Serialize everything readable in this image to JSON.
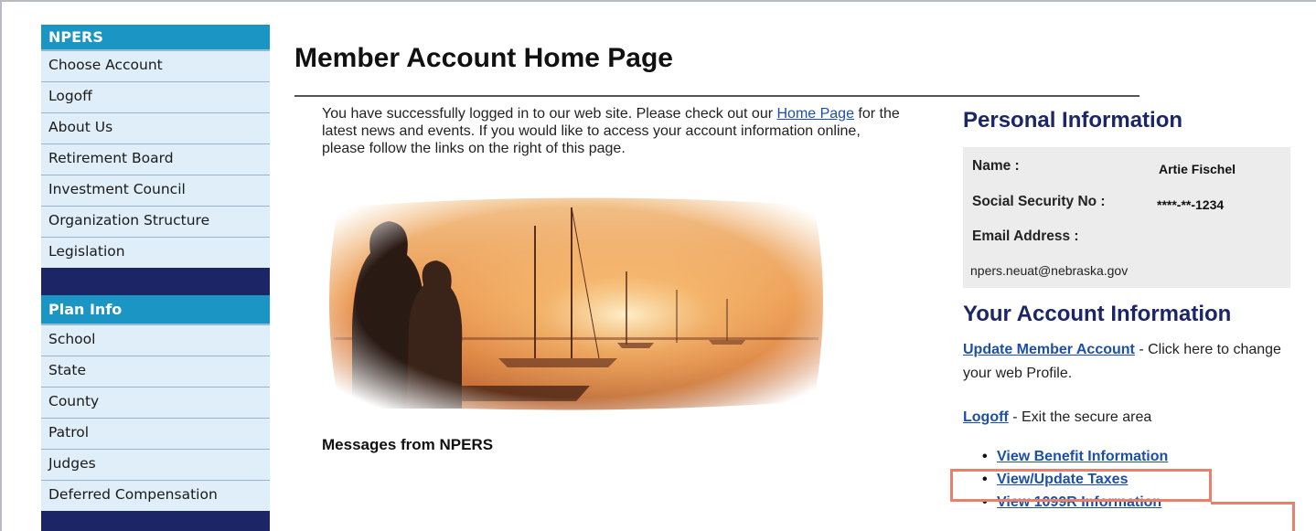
{
  "sidebar": {
    "section1_title": "NPERS",
    "section1_items": [
      {
        "label": "Choose Account"
      },
      {
        "label": "Logoff"
      },
      {
        "label": "About Us"
      },
      {
        "label": "Retirement Board"
      },
      {
        "label": "Investment Council"
      },
      {
        "label": "Organization Structure"
      },
      {
        "label": "Legislation"
      }
    ],
    "section2_title": "Plan Info",
    "section2_items": [
      {
        "label": "School"
      },
      {
        "label": "State"
      },
      {
        "label": "County"
      },
      {
        "label": "Patrol"
      },
      {
        "label": "Judges"
      },
      {
        "label": "Deferred Compensation"
      }
    ]
  },
  "main": {
    "title": "Member Account Home Page",
    "intro_before": "You have successfully logged in to our web site. Please check out our ",
    "intro_link": "Home Page",
    "intro_after": " for the latest news and events. If you would like to access your account information online, please follow the links on the right of this page.",
    "messages_title": "Messages from NPERS"
  },
  "personal": {
    "title": "Personal Information",
    "name_label": "Name :",
    "name_value": "Artie Fischel",
    "ssn_label": "Social Security No :",
    "ssn_value": "****-**-1234",
    "email_label": "Email Address :",
    "email_value": "npers.neuat@nebraska.gov"
  },
  "account": {
    "title": "Your Account Information",
    "update_link": "Update Member Account",
    "update_text": " - Click here to change your web Profile.",
    "logoff_link": "Logoff",
    "logoff_text": " - Exit the secure area",
    "links": [
      {
        "label": "View Benefit Information"
      },
      {
        "label": "View/Update Taxes"
      },
      {
        "label": "View 1099R Information"
      }
    ]
  },
  "colors": {
    "sidebar_dark": "#1c2566",
    "sidebar_header": "#1a95c4",
    "sidebar_item_bg": "#dfeef8",
    "link": "#1c4fa8",
    "highlight": "#e8806c"
  }
}
